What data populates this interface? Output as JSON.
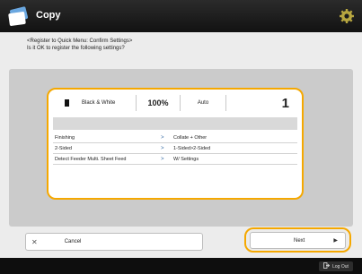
{
  "header": {
    "title": "Copy"
  },
  "message": {
    "line1": "<Register to Quick Menu: Confirm Settings>",
    "line2": "Is it OK to register the following settings?"
  },
  "summary": {
    "color_mode": "Black & White",
    "ratio": "100%",
    "paper": "Auto",
    "copies": "1"
  },
  "settings": [
    {
      "label": "Finishing",
      "value": "Collate + Other"
    },
    {
      "label": "2-Sided",
      "value": "1-Sided>2-Sided"
    },
    {
      "label": "Detect Feeder Multi. Sheet Feed",
      "value": "W/ Settings"
    }
  ],
  "buttons": {
    "cancel": "Cancel",
    "next": "Next",
    "logout": "Log Out"
  },
  "colors": {
    "accent": "#f5a800",
    "titlebar": "#1a1a1a"
  },
  "icons": {
    "app": "copy-icon",
    "settings": "gear-icon",
    "cancel": "close-icon",
    "next": "arrow-right-icon",
    "logout": "logout-icon"
  }
}
